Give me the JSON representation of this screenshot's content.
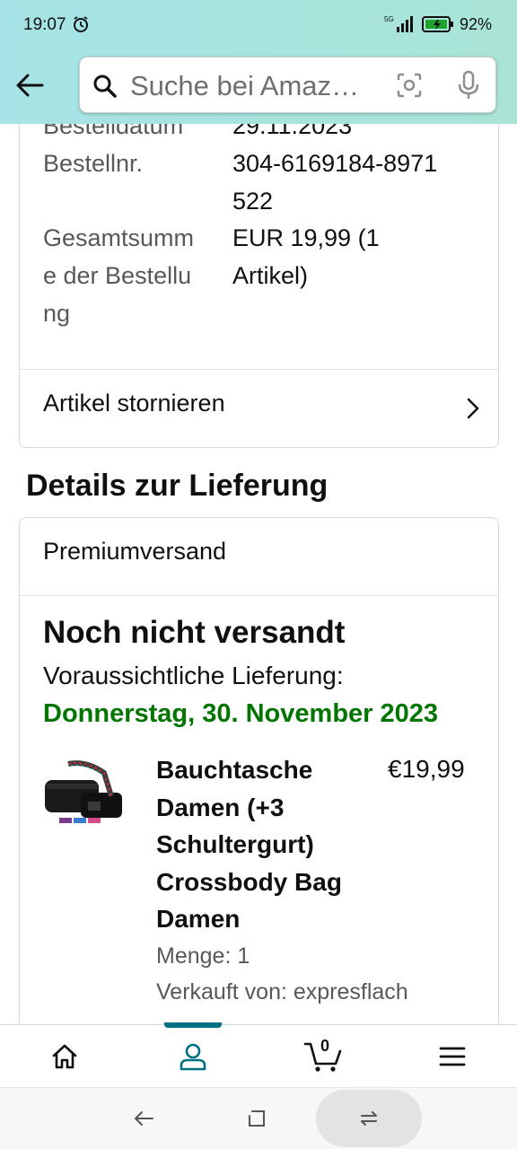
{
  "status_bar": {
    "time": "19:07",
    "network": "5G",
    "battery": "92%"
  },
  "search": {
    "placeholder": "Suche bei Amaz…"
  },
  "order_summary": {
    "rows": [
      {
        "label": "Bestelldatum",
        "value": "29.11.2023"
      },
      {
        "label": "Bestellnr.",
        "value": "304-6169184-8971522"
      },
      {
        "label": "Gesamtsumme der Bestellung",
        "value": "EUR 19,99 (1 Artikel)"
      }
    ],
    "cancel_label": "Artikel stornieren"
  },
  "delivery": {
    "section_title": "Details zur Lieferung",
    "shipping_type": "Premiumversand",
    "status": "Noch nicht versandt",
    "eta_label": "Voraussichtliche Lieferung:",
    "eta_date": "Donnerstag, 30. November 2023",
    "eta_color": "#007600"
  },
  "product": {
    "title": "Bauchtasche Damen (+3 Schultergurt) Crossbody Bag Damen",
    "price": "€19,99",
    "quantity": "Menge: 1",
    "seller": "Verkauft von: expresflach"
  },
  "bottom_nav": {
    "items": [
      {
        "name": "home",
        "icon": "home-icon"
      },
      {
        "name": "account",
        "icon": "person-icon",
        "active": true
      },
      {
        "name": "cart",
        "icon": "cart-icon",
        "count": "0"
      },
      {
        "name": "menu",
        "icon": "hamburger-icon"
      }
    ],
    "accent": "#007185"
  }
}
